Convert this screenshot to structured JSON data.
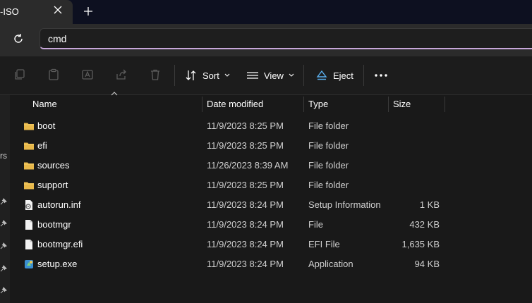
{
  "tab": {
    "title": "-ISO"
  },
  "address": {
    "value": "cmd"
  },
  "toolbar": {
    "sort_label": "Sort",
    "view_label": "View",
    "eject_label": "Eject"
  },
  "left_pane": {
    "partial_text": "rs"
  },
  "columns": {
    "name": "Name",
    "date": "Date modified",
    "type": "Type",
    "size": "Size"
  },
  "files": [
    {
      "name": "boot",
      "date": "11/9/2023 8:25 PM",
      "type": "File folder",
      "size": "",
      "icon": "folder-icon"
    },
    {
      "name": "efi",
      "date": "11/9/2023 8:25 PM",
      "type": "File folder",
      "size": "",
      "icon": "folder-icon"
    },
    {
      "name": "sources",
      "date": "11/26/2023 8:39 AM",
      "type": "File folder",
      "size": "",
      "icon": "folder-icon"
    },
    {
      "name": "support",
      "date": "11/9/2023 8:25 PM",
      "type": "File folder",
      "size": "",
      "icon": "folder-icon"
    },
    {
      "name": "autorun.inf",
      "date": "11/9/2023 8:24 PM",
      "type": "Setup Information",
      "size": "1 KB",
      "icon": "settings-file-icon"
    },
    {
      "name": "bootmgr",
      "date": "11/9/2023 8:24 PM",
      "type": "File",
      "size": "432 KB",
      "icon": "file-icon"
    },
    {
      "name": "bootmgr.efi",
      "date": "11/9/2023 8:24 PM",
      "type": "EFI File",
      "size": "1,635 KB",
      "icon": "file-icon"
    },
    {
      "name": "setup.exe",
      "date": "11/9/2023 8:24 PM",
      "type": "Application",
      "size": "94 KB",
      "icon": "setup-app-icon"
    }
  ],
  "colors": {
    "accent_underline": "#c7a7d9",
    "folder": "#e8b84a",
    "eject": "#5ab0f0"
  }
}
